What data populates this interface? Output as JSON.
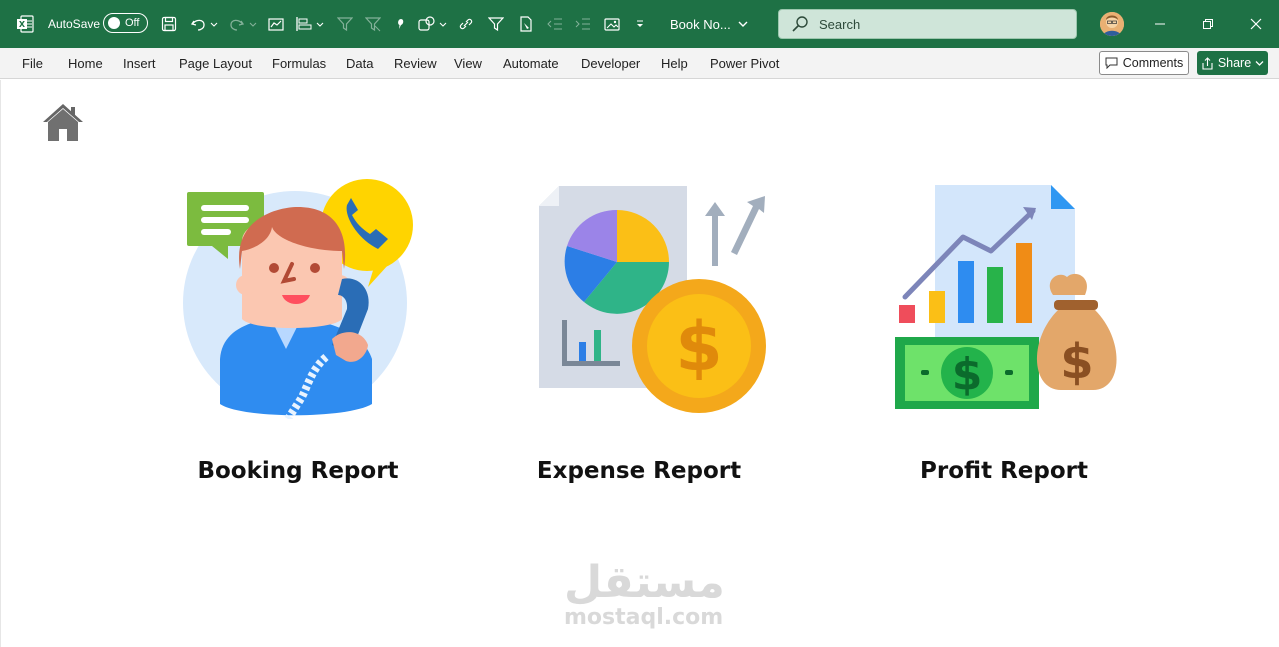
{
  "titlebar": {
    "app_icon": "excel-icon",
    "autosave_label": "AutoSave",
    "autosave_state": "Off",
    "filename": "Book No...",
    "search_placeholder": "Search",
    "colors": {
      "bar": "#1e7145"
    }
  },
  "ribbon": {
    "tabs": [
      "File",
      "Home",
      "Insert",
      "Page Layout",
      "Formulas",
      "Data",
      "Review",
      "View",
      "Automate",
      "Developer",
      "Help",
      "Power Pivot"
    ],
    "comments_label": "Comments",
    "share_label": "Share"
  },
  "sheet": {
    "home_icon": "home-icon",
    "reports": [
      {
        "title": "Booking Report",
        "icon": "call-center-icon"
      },
      {
        "title": "Expense Report",
        "icon": "expense-chart-coin-icon"
      },
      {
        "title": "Profit Report",
        "icon": "profit-chart-money-icon"
      }
    ],
    "watermark": {
      "arabic": "مستقل",
      "latin": "mostaql.com"
    }
  }
}
